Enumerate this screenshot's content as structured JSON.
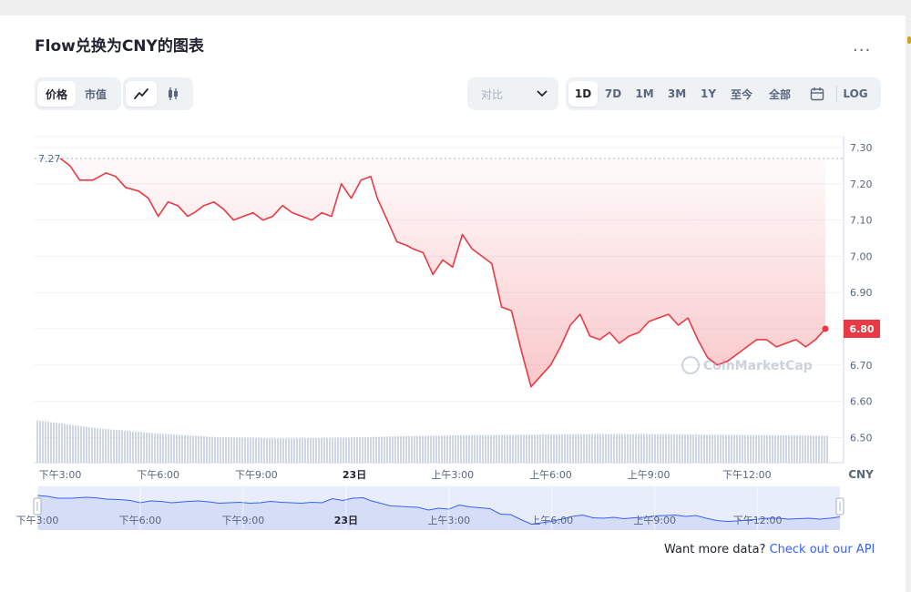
{
  "title": "Flow兑换为CNY的图表",
  "more_label": "...",
  "metric_tabs": [
    "价格",
    "市值"
  ],
  "compare": {
    "label": "对比"
  },
  "range_tabs": [
    "1D",
    "7D",
    "1M",
    "3M",
    "1Y",
    "至今",
    "全部"
  ],
  "log_label": "LOG",
  "watermark": "CoinMarketCap",
  "footer": {
    "text": "Want more data?",
    "link": "Check out our API"
  },
  "colors": {
    "line": "#ea3943",
    "accent": "#3861fb",
    "volume": "#cfd6e4"
  },
  "icons": [
    "line-chart-icon",
    "candlestick-icon",
    "chevron-down-icon",
    "calendar-icon",
    "more-icon",
    "coinmarketcap-logo-icon"
  ],
  "chart_data": {
    "type": "line",
    "currency": "CNY",
    "open_price_label": "7.27",
    "current_price_label": "6.80",
    "ylim": [
      6.45,
      7.32
    ],
    "y_ticks": [
      "7.30",
      "7.20",
      "7.10",
      "7.00",
      "6.90",
      "6.80",
      "6.70",
      "6.60",
      "6.50"
    ],
    "x_tick_labels": [
      "下午3:00",
      "下午6:00",
      "下午9:00",
      "23日",
      "上午3:00",
      "上午6:00",
      "上午9:00",
      "下午12:00"
    ],
    "nav_tick_labels": [
      "下午3:00",
      "下午6:00",
      "下午9:00",
      "23日",
      "上午3:00",
      "上午6:00",
      "上午9:00",
      "下午12:00"
    ],
    "x_hours": [
      0,
      3,
      6,
      9,
      12,
      15,
      18,
      21
    ],
    "series": [
      {
        "t": [
          0,
          0.3,
          0.6,
          1.0,
          1.4,
          1.7,
          2.0,
          2.4,
          2.7,
          3.0,
          3.3,
          3.6,
          3.9,
          4.1,
          4.4,
          4.7,
          5.0,
          5.3,
          5.6,
          5.9,
          6.2,
          6.5,
          6.8,
          7.1,
          7.4,
          7.7,
          8.0,
          8.3,
          8.6,
          8.9,
          9.2,
          9.5,
          9.7,
          10.0,
          10.3,
          10.6,
          10.8,
          11.1,
          11.4,
          11.7,
          12.0,
          12.3,
          12.6,
          12.9,
          13.2,
          13.5,
          13.8,
          14.1,
          14.4,
          14.7,
          15.0,
          15.3,
          15.6,
          15.9,
          16.2,
          16.5,
          16.8,
          17.1,
          17.4,
          17.7,
          18.0,
          18.3,
          18.6,
          18.9,
          19.2,
          19.5,
          19.8,
          20.1,
          20.4,
          20.7,
          21.0,
          21.3,
          21.6,
          21.9,
          22.2,
          22.5,
          22.8,
          23.1,
          23.4
        ],
        "values": [
          7.27,
          7.25,
          7.21,
          7.21,
          7.23,
          7.22,
          7.19,
          7.18,
          7.16,
          7.11,
          7.15,
          7.14,
          7.11,
          7.12,
          7.14,
          7.15,
          7.13,
          7.1,
          7.11,
          7.12,
          7.1,
          7.11,
          7.14,
          7.12,
          7.11,
          7.1,
          7.12,
          7.11,
          7.2,
          7.16,
          7.21,
          7.22,
          7.16,
          7.1,
          7.04,
          7.03,
          7.02,
          7.01,
          6.95,
          6.99,
          6.97,
          7.06,
          7.02,
          7.0,
          6.98,
          6.86,
          6.85,
          6.74,
          6.64,
          6.67,
          6.7,
          6.75,
          6.81,
          6.84,
          6.78,
          6.77,
          6.79,
          6.76,
          6.78,
          6.79,
          6.82,
          6.83,
          6.84,
          6.81,
          6.83,
          6.77,
          6.72,
          6.7,
          6.71,
          6.73,
          6.75,
          6.77,
          6.77,
          6.75,
          6.76,
          6.77,
          6.75,
          6.77,
          6.8
        ]
      }
    ],
    "volume_levels": [
      0.8,
      0.65,
      0.55,
      0.48,
      0.46,
      0.47,
      0.5,
      0.52,
      0.53,
      0.54,
      0.54,
      0.53,
      0.52,
      0.51
    ]
  }
}
